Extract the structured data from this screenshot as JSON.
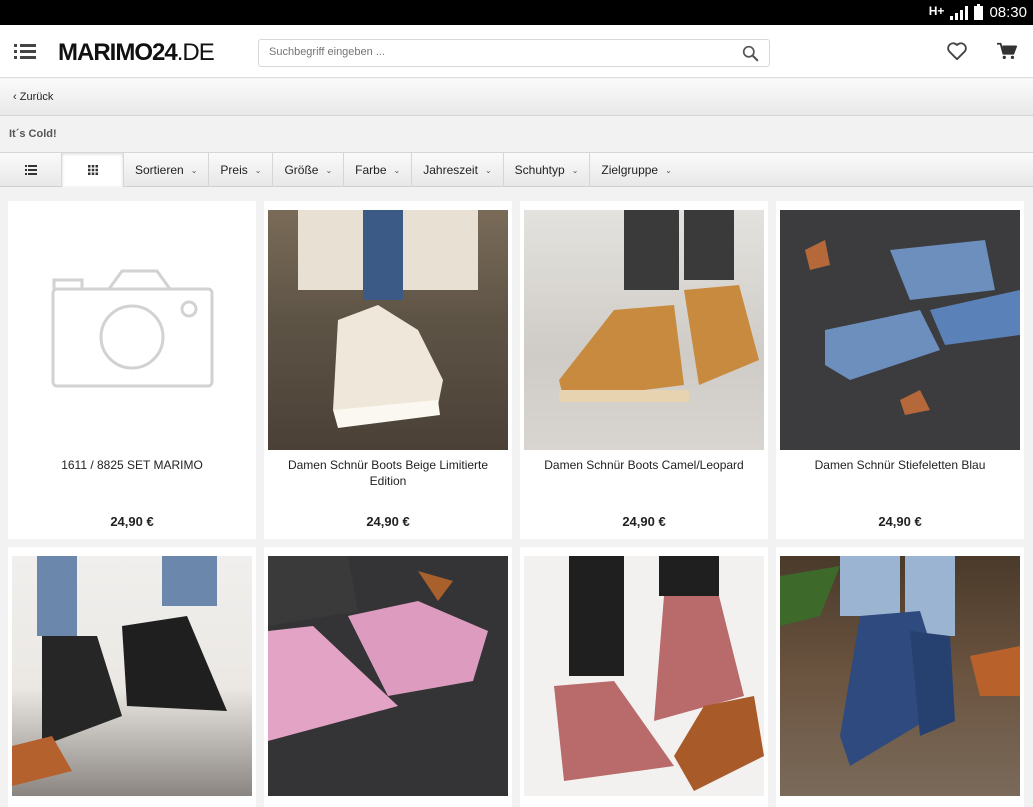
{
  "status_bar": {
    "network": "H+",
    "time": "08:30"
  },
  "header": {
    "logo_bold": "MARIMO24",
    "logo_thin": ".DE",
    "search_placeholder": "Suchbegriff eingeben ..."
  },
  "nav": {
    "back_label": "Zurück"
  },
  "category": {
    "title": "It´s Cold!"
  },
  "filters": [
    "Sortieren",
    "Preis",
    "Größe",
    "Farbe",
    "Jahreszeit",
    "Schuhtyp",
    "Zielgruppe"
  ],
  "products": [
    {
      "name": "1611 / 8825 SET MARIMO",
      "price": "24,90 €"
    },
    {
      "name": "Damen Schnür Boots Beige Limitierte Edition",
      "price": "24,90 €"
    },
    {
      "name": "Damen Schnür Boots Camel/Leopard",
      "price": "24,90 €"
    },
    {
      "name": "Damen Schnür Stiefeletten Blau",
      "price": "24,90 €"
    },
    {
      "name": "",
      "price": ""
    },
    {
      "name": "",
      "price": ""
    },
    {
      "name": "",
      "price": ""
    },
    {
      "name": "",
      "price": ""
    }
  ],
  "colors": {
    "header_bg": "#ffffff",
    "statusbar_bg": "#000000",
    "page_bg": "#f2f2f2"
  }
}
